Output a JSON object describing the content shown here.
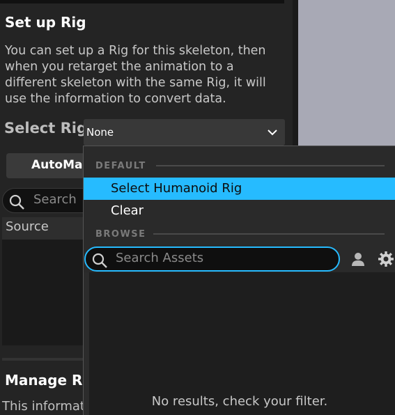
{
  "rig_setup": {
    "title": "Set up Rig",
    "description": "You can set up a Rig for this skeleton, then when you retarget the animation to a different skeleton with the same Rig, it will use the information to convert data.",
    "select_label": "Select Rig",
    "selected_value": "None"
  },
  "toolbar": {
    "automap_label": "AutoMap",
    "search_placeholder": "Search"
  },
  "mapping_table": {
    "source_header": "Source"
  },
  "manage": {
    "title": "Manage Ret",
    "description": "This informat"
  },
  "dropdown": {
    "default_heading": "DEFAULT",
    "items": [
      "Select Humanoid Rig",
      "Clear"
    ],
    "browse_heading": "BROWSE",
    "search_placeholder": "Search Assets",
    "empty_message": "No results, check your filter."
  },
  "icons": [
    "chevron-down-icon",
    "search-icon",
    "user-icon",
    "gear-icon"
  ],
  "colors": {
    "accent": "#26bbff",
    "panel": "#242424",
    "menu": "#2a2a2a"
  }
}
